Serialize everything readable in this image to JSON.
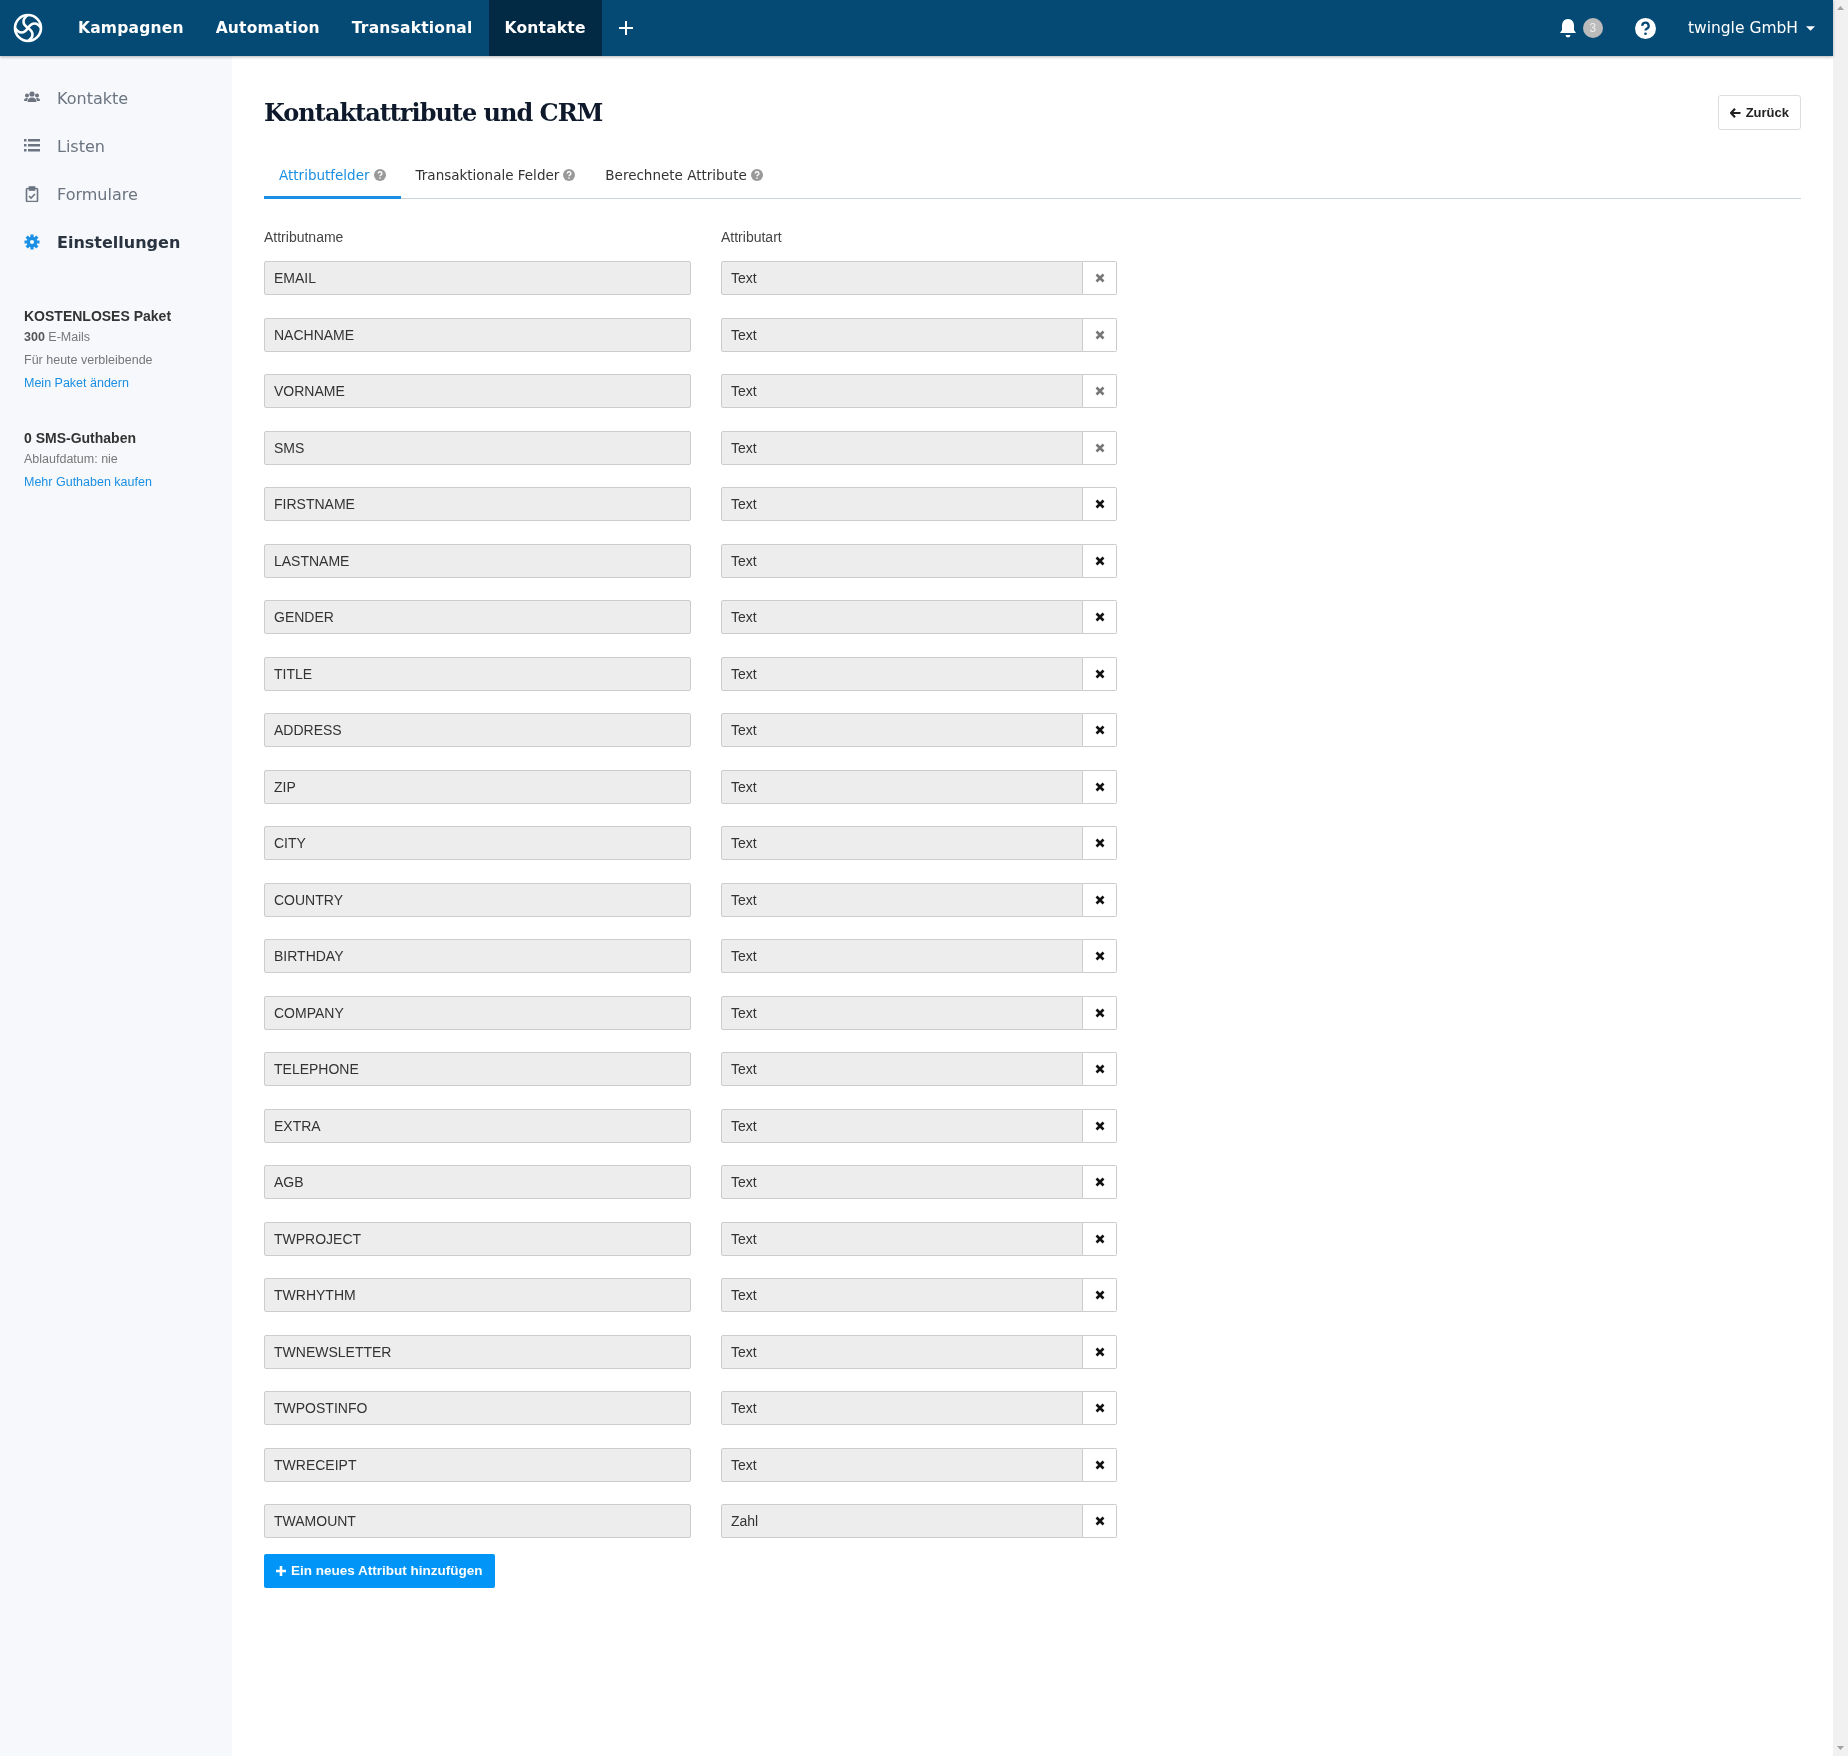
{
  "topbar": {
    "nav": [
      {
        "label": "Kampagnen",
        "selected": false
      },
      {
        "label": "Automation",
        "selected": false
      },
      {
        "label": "Transaktional",
        "selected": false
      },
      {
        "label": "Kontakte",
        "selected": true
      }
    ],
    "notifications": "3",
    "account": "twingle GmbH"
  },
  "sidebar": {
    "items": [
      {
        "label": "Kontakte",
        "kind": "users",
        "selected": false
      },
      {
        "label": "Listen",
        "kind": "list",
        "selected": false
      },
      {
        "label": "Formulare",
        "kind": "clipboard",
        "selected": false
      },
      {
        "label": "Einstellungen",
        "kind": "gear",
        "selected": true
      }
    ],
    "plan": {
      "title": "KOSTENLOSES Paket",
      "emails": "**300** E-Mails",
      "note": "Für heute verbleibende",
      "link": "Mein Paket ändern"
    },
    "sms": {
      "title": "0 SMS-Guthaben",
      "expiry": "Ablaufdatum: nie",
      "link": "Mehr Guthaben kaufen"
    }
  },
  "page": {
    "title": "Kontaktattribute und CRM",
    "back_button": "Zurück",
    "tabs": [
      {
        "label": "Attributfelder",
        "selected": true
      },
      {
        "label": "Transaktionale Felder",
        "selected": false
      },
      {
        "label": "Berechnete Attribute",
        "selected": false
      }
    ],
    "columns": [
      "Attributname",
      "Attributart"
    ],
    "attributes": [
      {
        "name": "EMAIL",
        "type": "Text",
        "disabled": true
      },
      {
        "name": "NACHNAME",
        "type": "Text",
        "disabled": true
      },
      {
        "name": "VORNAME",
        "type": "Text",
        "disabled": true
      },
      {
        "name": "SMS",
        "type": "Text",
        "disabled": true
      },
      {
        "name": "FIRSTNAME",
        "type": "Text",
        "disabled": false
      },
      {
        "name": "LASTNAME",
        "type": "Text",
        "disabled": false
      },
      {
        "name": "GENDER",
        "type": "Text",
        "disabled": false
      },
      {
        "name": "TITLE",
        "type": "Text",
        "disabled": false
      },
      {
        "name": "ADDRESS",
        "type": "Text",
        "disabled": false
      },
      {
        "name": "ZIP",
        "type": "Text",
        "disabled": false
      },
      {
        "name": "CITY",
        "type": "Text",
        "disabled": false
      },
      {
        "name": "COUNTRY",
        "type": "Text",
        "disabled": false
      },
      {
        "name": "BIRTHDAY",
        "type": "Text",
        "disabled": false
      },
      {
        "name": "COMPANY",
        "type": "Text",
        "disabled": false
      },
      {
        "name": "TELEPHONE",
        "type": "Text",
        "disabled": false
      },
      {
        "name": "EXTRA",
        "type": "Text",
        "disabled": false
      },
      {
        "name": "AGB",
        "type": "Text",
        "disabled": false
      },
      {
        "name": "TWPROJECT",
        "type": "Text",
        "disabled": false
      },
      {
        "name": "TWRHYTHM",
        "type": "Text",
        "disabled": false
      },
      {
        "name": "TWNEWSLETTER",
        "type": "Text",
        "disabled": false
      },
      {
        "name": "TWPOSTINFO",
        "type": "Text",
        "disabled": false
      },
      {
        "name": "TWRECEIPT",
        "type": "Text",
        "disabled": false
      },
      {
        "name": "TWAMOUNT",
        "type": "Zahl",
        "disabled": false
      }
    ],
    "add_button": "Ein neues Attribut hinzufügen"
  }
}
